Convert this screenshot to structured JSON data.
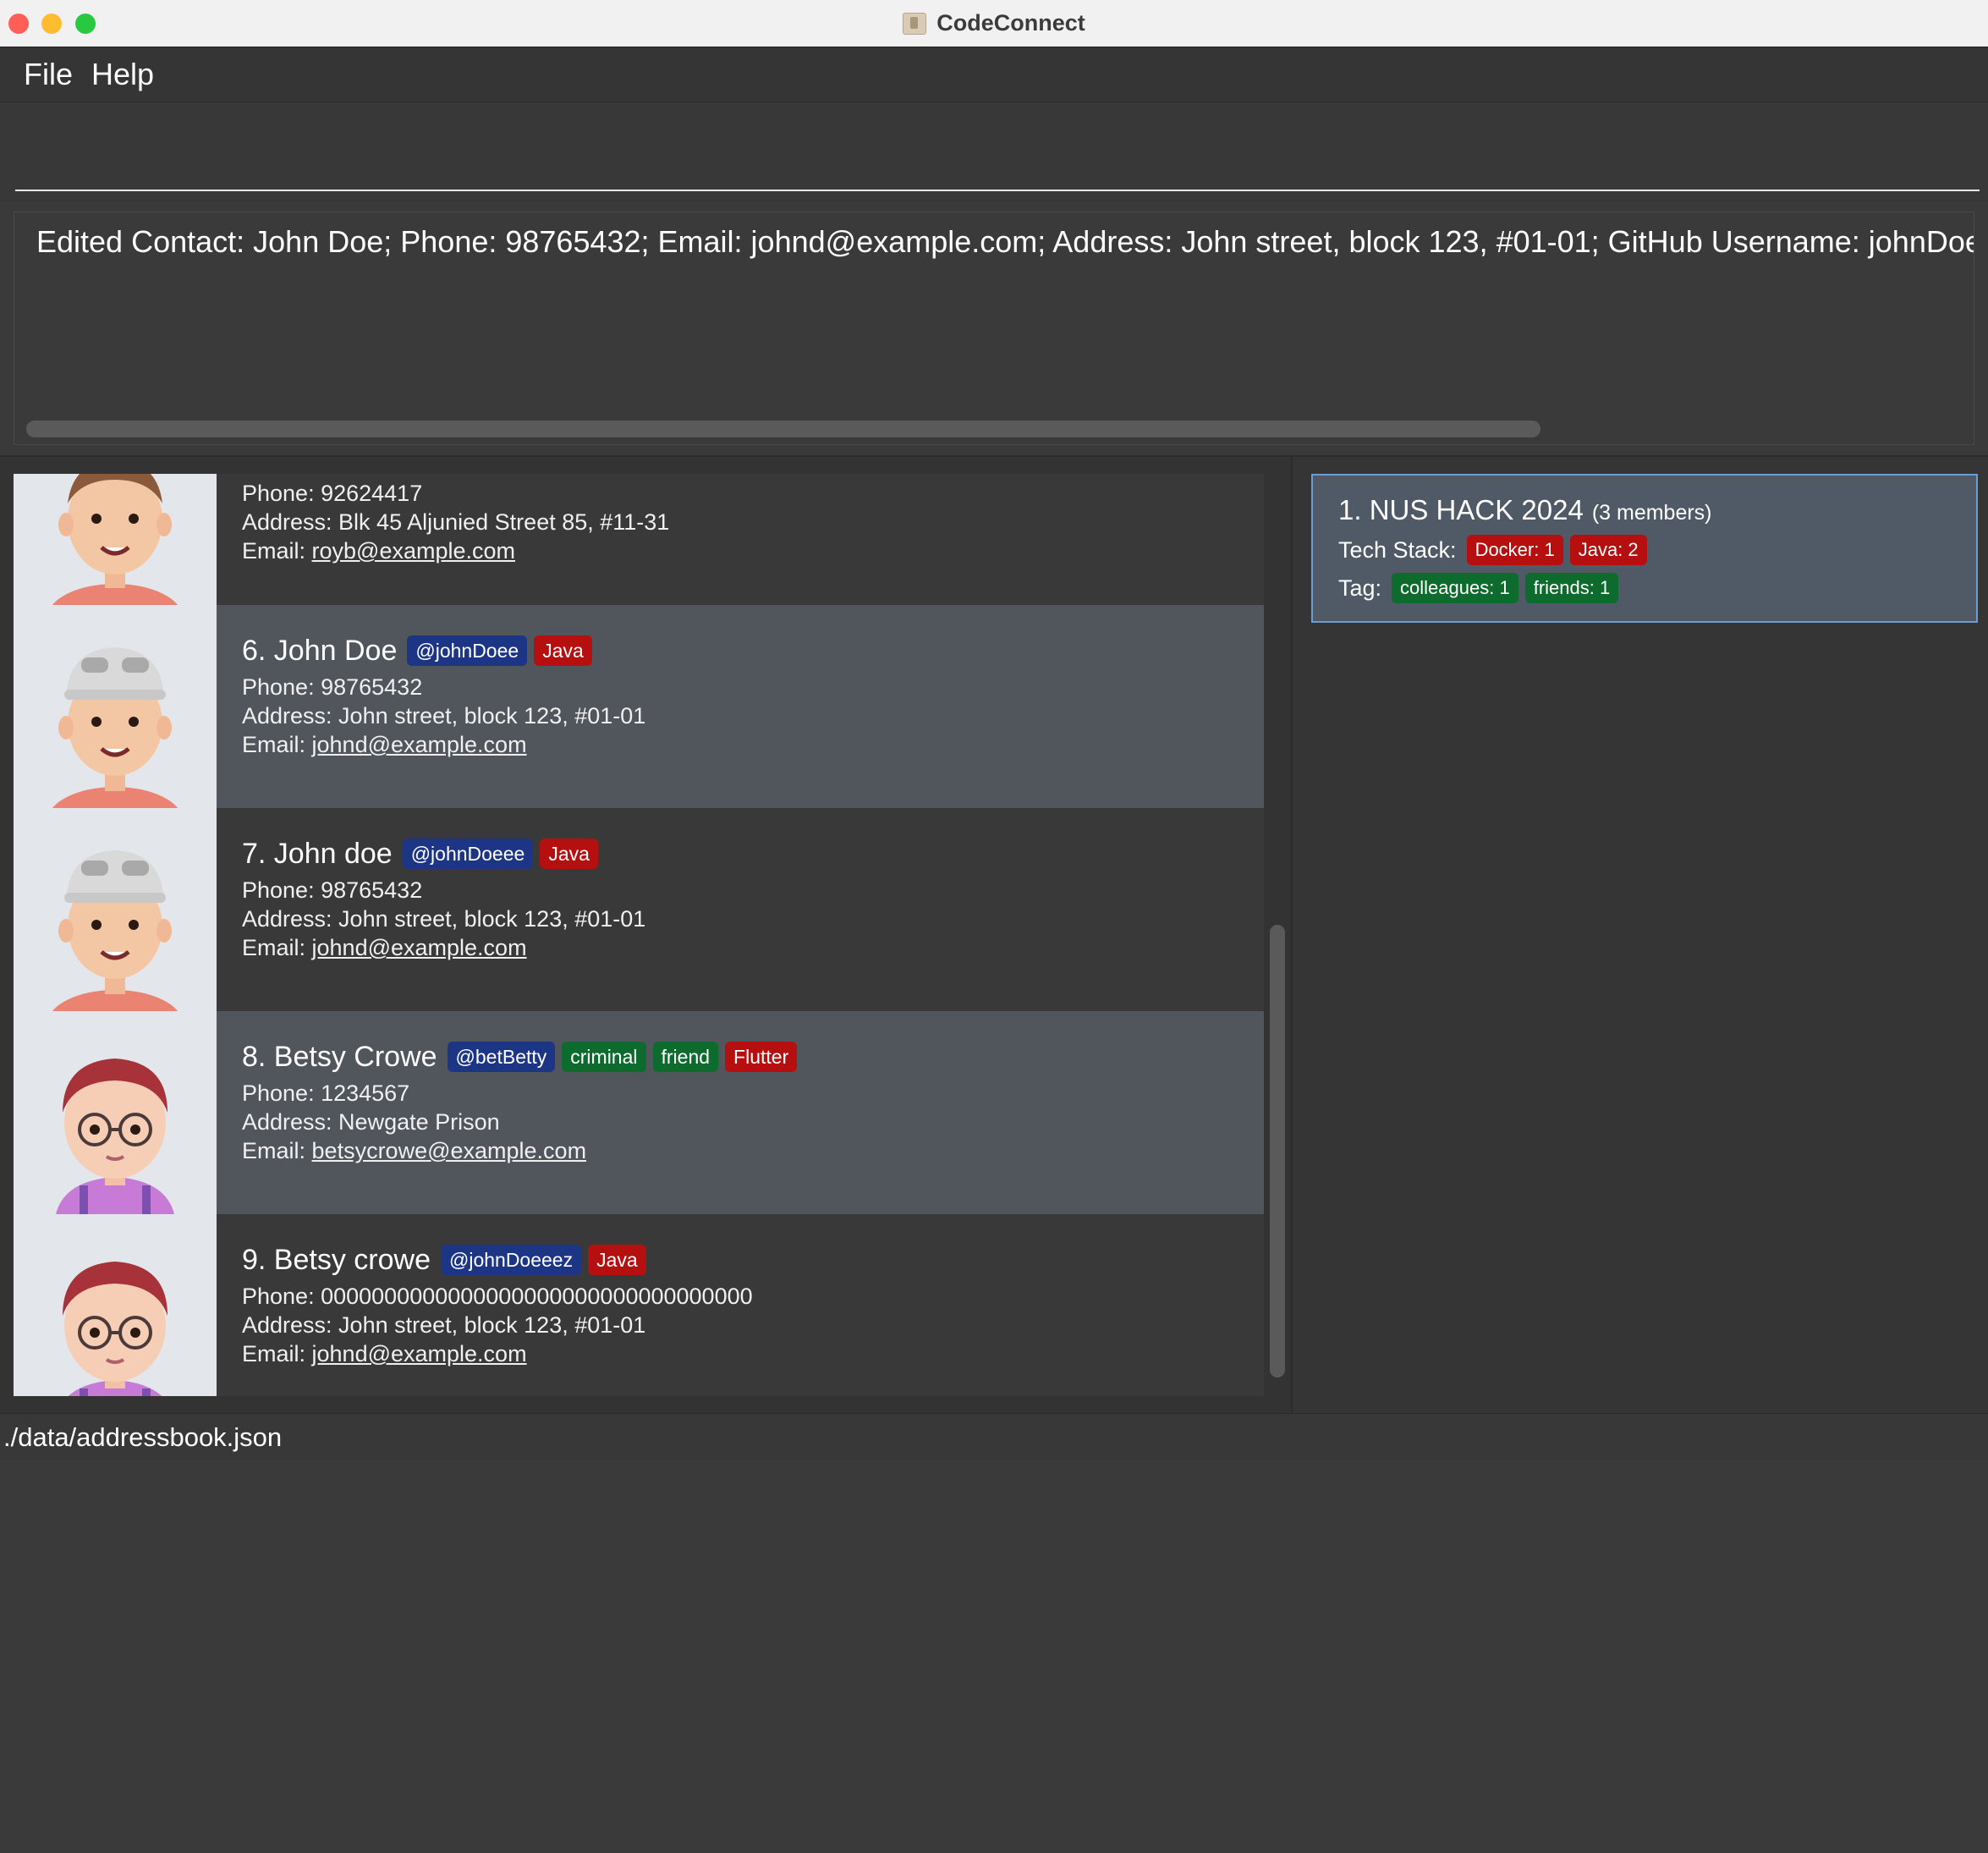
{
  "window": {
    "title": "CodeConnect"
  },
  "menu": {
    "file": "File",
    "help": "Help"
  },
  "command": {
    "value": ""
  },
  "result": {
    "text": "Edited Contact: John Doe; Phone: 98765432; Email: johnd@example.com; Address: John street, block 123, #01-01; GitHub Username: johnDoee; P"
  },
  "persons": [
    {
      "name": "",
      "github": "",
      "badges": [],
      "phone": "Phone: 92624417",
      "address": "Address: Blk 45 Aljunied Street 85, #11-31",
      "email_label": "Email:",
      "email": "royb@example.com",
      "avatar": "boy-avatar"
    },
    {
      "name": "6.  John Doe",
      "github": "@johnDoee",
      "tags": [],
      "tech": [
        "Java"
      ],
      "phone": "Phone: 98765432",
      "address": "Address: John street, block 123, #01-01",
      "email_label": "Email:",
      "email": "johnd@example.com",
      "avatar": "boy-cap-avatar"
    },
    {
      "name": "7.  John doe",
      "github": "@johnDoeee",
      "tags": [],
      "tech": [
        "Java"
      ],
      "phone": "Phone: 98765432",
      "address": "Address: John street, block 123, #01-01",
      "email_label": "Email:",
      "email": "johnd@example.com",
      "avatar": "boy-cap-avatar"
    },
    {
      "name": "8.  Betsy Crowe",
      "github": "@betBetty",
      "tags": [
        "criminal",
        "friend"
      ],
      "tech": [
        "Flutter"
      ],
      "phone": "Phone: 1234567",
      "address": "Address: Newgate Prison",
      "email_label": "Email:",
      "email": "betsycrowe@example.com",
      "avatar": "girl-glasses-avatar"
    },
    {
      "name": "9.  Betsy crowe",
      "github": "@johnDoeeez",
      "tags": [],
      "tech": [
        "Java"
      ],
      "phone": "Phone: 0000000000000000000000000000000000",
      "address": "Address: John street, block 123, #01-01",
      "email_label": "Email:",
      "email": "johnd@example.com",
      "avatar": "girl-glasses-avatar"
    }
  ],
  "team": {
    "name": "1.  NUS HACK 2024",
    "members": "(3 members)",
    "tech_label": "Tech Stack:",
    "tech": [
      "Docker: 1",
      "Java: 2"
    ],
    "tag_label": "Tag:",
    "tags": [
      "colleagues: 1",
      "friends: 1"
    ]
  },
  "status": {
    "path": "./data/addressbook.json"
  },
  "colors": {
    "github_badge": "#1d3585",
    "tech_badge": "#b50f0f",
    "tag_badge": "#0e6b2e",
    "selected_team_border": "#6a9ed1"
  }
}
